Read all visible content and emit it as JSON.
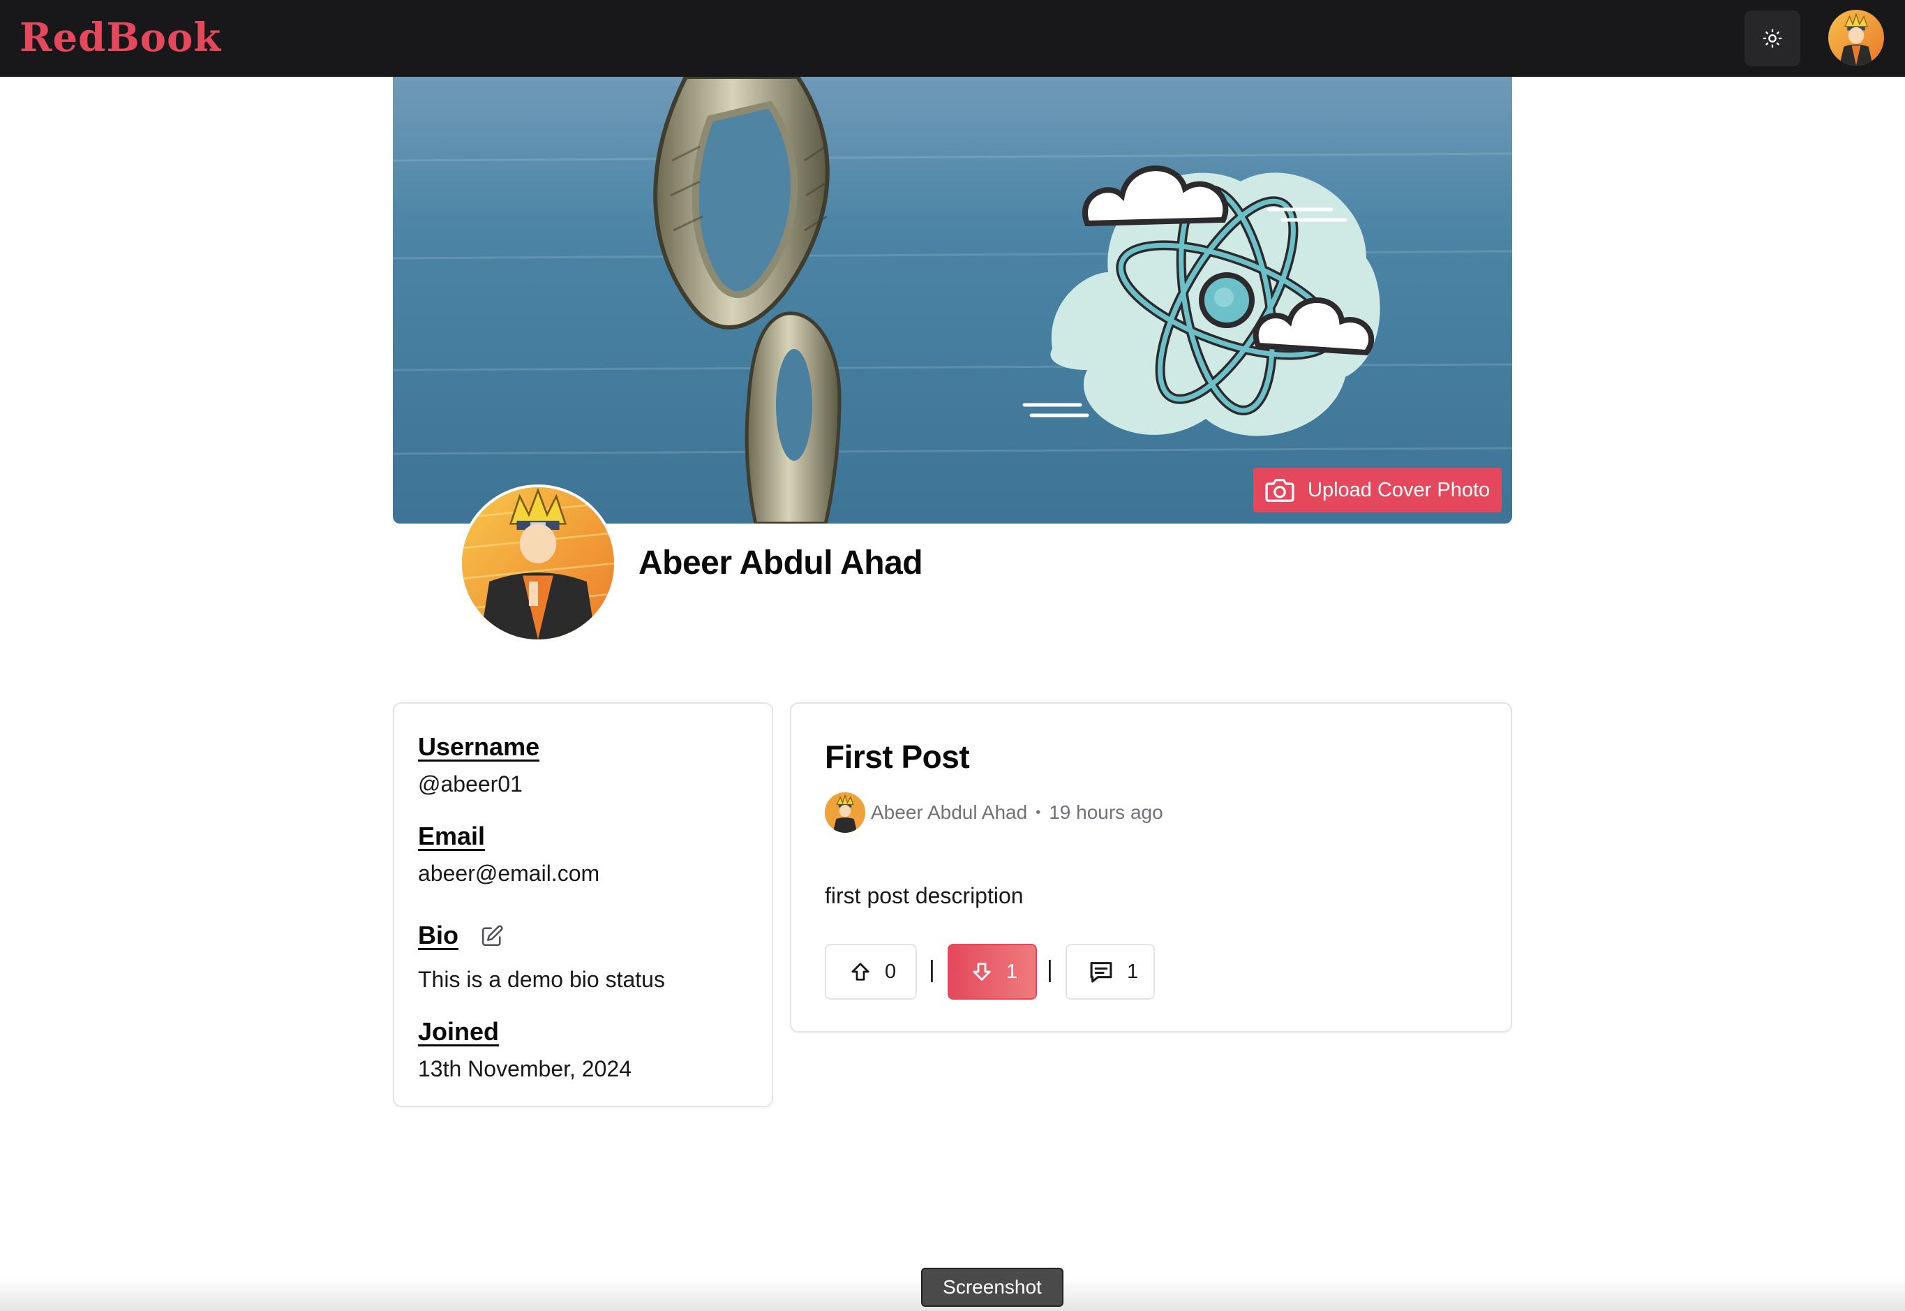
{
  "app": {
    "logo_text": "RedBook",
    "brand_color": "#e5485d"
  },
  "navbar": {
    "theme_toggle_icon": "sun-icon",
    "user_avatar": "user-avatar"
  },
  "cover": {
    "upload_label": "Upload Cover Photo",
    "upload_icon": "camera-icon"
  },
  "profile": {
    "name": "Abeer Abdul Ahad"
  },
  "info": {
    "username_label": "Username",
    "username_value": "@abeer01",
    "email_label": "Email",
    "email_value": "abeer@email.com",
    "bio_label": "Bio",
    "bio_edit_icon": "edit-icon",
    "bio_value": "This is a demo bio status",
    "joined_label": "Joined",
    "joined_value": "13th November, 2024"
  },
  "post": {
    "title": "First Post",
    "author": "Abeer Abdul Ahad",
    "separator": "•",
    "time": "19 hours ago",
    "description": "first post description",
    "upvotes": "0",
    "downvotes": "1",
    "comments": "1",
    "divider": "|"
  },
  "overlay": {
    "screenshot_label": "Screenshot"
  }
}
